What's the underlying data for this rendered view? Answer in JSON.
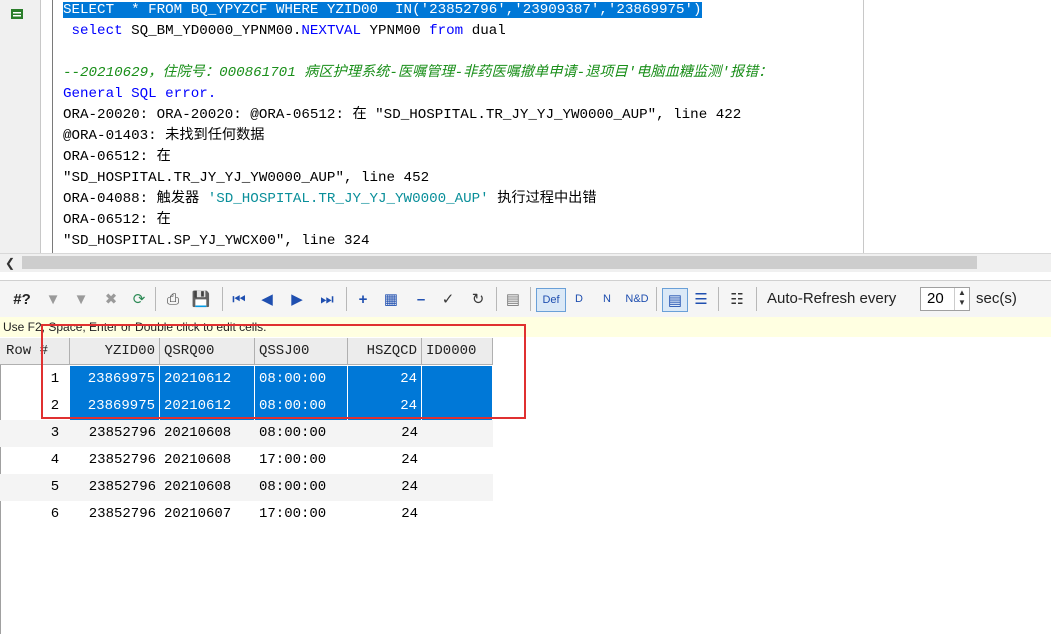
{
  "editor": {
    "lines": [
      {
        "segments": [
          {
            "t": "SELECT  * FROM BQ_YPYZCF WHERE YZID00  IN('23852796','23909387','23869975')",
            "c": "sel"
          }
        ]
      },
      {
        "segments": [
          {
            "t": " select ",
            "c": "kw"
          },
          {
            "t": "SQ_BM_YD0000_YPNM00.",
            "c": "ident"
          },
          {
            "t": "NEXTVAL",
            "c": "kw"
          },
          {
            "t": " YPNM00 ",
            "c": "ident"
          },
          {
            "t": "from",
            "c": "kw"
          },
          {
            "t": " dual",
            "c": "ident"
          }
        ]
      },
      {
        "segments": [
          {
            "t": "",
            "c": "ident"
          }
        ]
      },
      {
        "segments": [
          {
            "t": "--20210629，住院号：000861701 病区护理系统-医嘱管理-非药医嘱撤单申请-退项目'电脑血糖监测'报错：",
            "c": "comment"
          }
        ]
      },
      {
        "segments": [
          {
            "t": "General SQL error.",
            "c": "kw"
          }
        ]
      },
      {
        "segments": [
          {
            "t": "ORA-20020: ORA-20020: @ORA-06512: 在 \"SD_HOSPITAL.TR_JY_YJ_YW0000_AUP\", line 422",
            "c": "black"
          }
        ]
      },
      {
        "segments": [
          {
            "t": "@ORA-01403: 未找到任何数据",
            "c": "black"
          }
        ]
      },
      {
        "segments": [
          {
            "t": "ORA-06512: 在",
            "c": "black"
          }
        ]
      },
      {
        "segments": [
          {
            "t": "\"SD_HOSPITAL.TR_JY_YJ_YW0000_AUP\", line 452",
            "c": "black"
          }
        ]
      },
      {
        "segments": [
          {
            "t": "ORA-04088: 触发器 ",
            "c": "black"
          },
          {
            "t": "'SD_HOSPITAL.TR_JY_YJ_YW0000_AUP'",
            "c": "str"
          },
          {
            "t": " 执行过程中出错",
            "c": "black"
          }
        ]
      },
      {
        "segments": [
          {
            "t": "ORA-06512: 在",
            "c": "black"
          }
        ]
      },
      {
        "segments": [
          {
            "t": "\"SD_HOSPITAL.SP_YJ_YWCX00\", line 324",
            "c": "black"
          }
        ]
      }
    ]
  },
  "toolbar": {
    "query_label": "#?",
    "auto_refresh_label": "Auto-Refresh every",
    "auto_refresh_value": "20",
    "auto_refresh_unit": "sec(s)"
  },
  "hint": "Use F2, Space, Enter or Double click to edit cells.",
  "grid": {
    "headers": [
      "Row #",
      "YZID00",
      "QSRQ00",
      "QSSJ00",
      "HSZQCD",
      "ID0000"
    ],
    "rows": [
      {
        "num": "1",
        "cells": [
          "23869975",
          "20210612",
          "08:00:00",
          "24",
          ""
        ],
        "selected": true
      },
      {
        "num": "2",
        "cells": [
          "23869975",
          "20210612",
          "08:00:00",
          "24",
          ""
        ],
        "selected": true
      },
      {
        "num": "3",
        "cells": [
          "23852796",
          "20210608",
          "08:00:00",
          "24",
          ""
        ],
        "selected": false
      },
      {
        "num": "4",
        "cells": [
          "23852796",
          "20210608",
          "17:00:00",
          "24",
          ""
        ],
        "selected": false
      },
      {
        "num": "5",
        "cells": [
          "23852796",
          "20210608",
          "08:00:00",
          "24",
          ""
        ],
        "selected": false
      },
      {
        "num": "6",
        "cells": [
          "23852796",
          "20210607",
          "17:00:00",
          "24",
          ""
        ],
        "selected": false
      }
    ]
  }
}
